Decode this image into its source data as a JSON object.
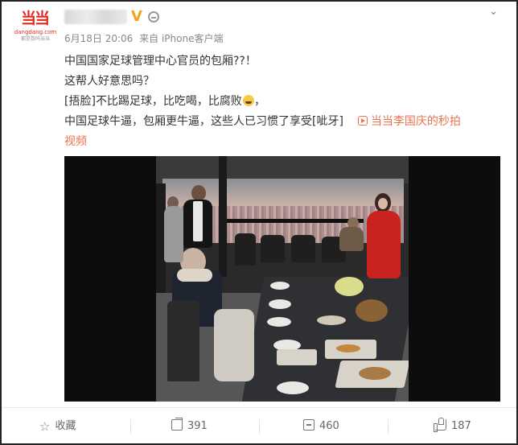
{
  "post": {
    "avatar": {
      "logo_text": "当当",
      "domain_text": "dangdang.com",
      "sub_text": "都是数码当当"
    },
    "author_badge": "V",
    "meta": {
      "date": "6月18日 20:06",
      "source": "来自 iPhone客户端"
    },
    "text": {
      "line1": "中国国家足球管理中心官员的包厢??！",
      "line2": "这帮人好意思吗？",
      "line3_tag": "[捂脸]",
      "line3_text": "不比踢足球，比吃喝，比腐败",
      "line3_end": "，",
      "line4_text": "中国足球牛逼，包厢更牛逼，这些人已习惯了享受[呲牙]",
      "video_link": "当当李国庆的秒拍",
      "video_link2": "视频"
    }
  },
  "footer": {
    "favorite": "收藏",
    "repost": "391",
    "comment": "460",
    "like": "187"
  },
  "colors": {
    "link": "#eb7350",
    "brand": "#e02a1e",
    "badge": "#f3a51a"
  },
  "icons": [
    "caret-down-icon",
    "level-icon",
    "video-play-icon",
    "star-icon",
    "share-icon",
    "comment-icon",
    "thumbs-up-icon"
  ]
}
